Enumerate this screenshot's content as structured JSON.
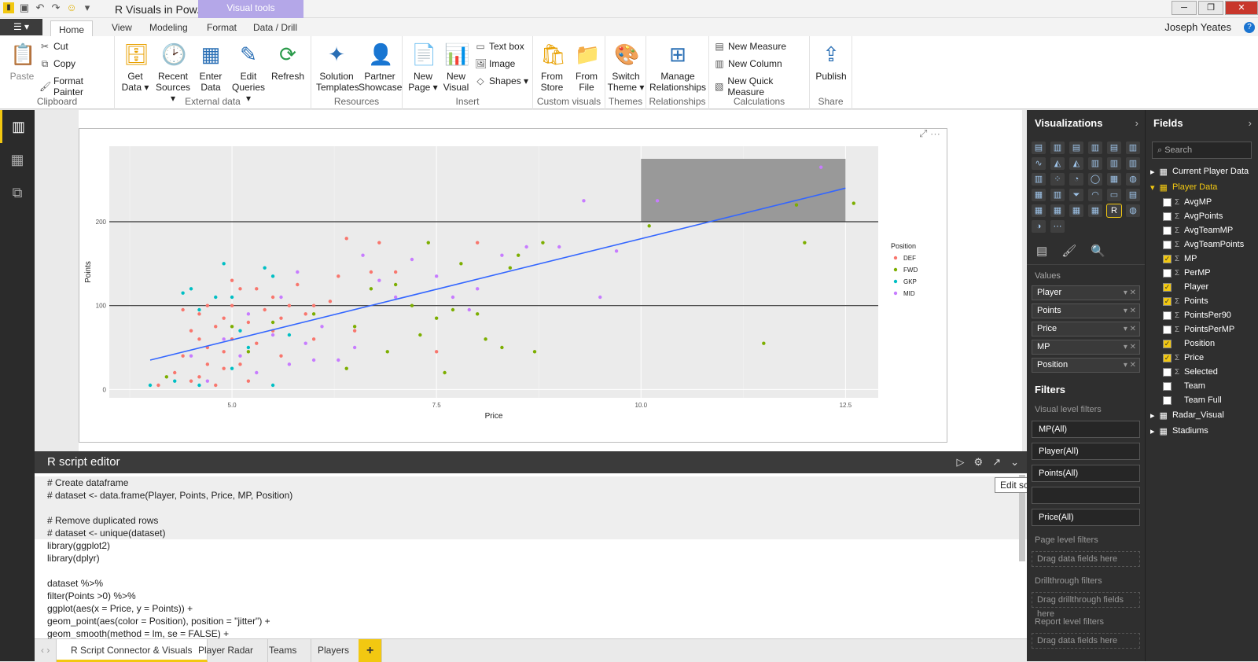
{
  "app": {
    "title": "R Visuals in Pow...",
    "context_tab": "Visual tools",
    "user": "Joseph Yeates"
  },
  "ribbon_tabs": [
    "Home",
    "View",
    "Modeling",
    "Format",
    "Data / Drill"
  ],
  "ribbon": {
    "clipboard": {
      "label": "Clipboard",
      "paste": "Paste",
      "cut": "Cut",
      "copy": "Copy",
      "format_painter": "Format Painter"
    },
    "external": {
      "label": "External data",
      "get_data": "Get Data ▾",
      "recent": "Recent Sources ▾",
      "enter": "Enter Data",
      "edit": "Edit Queries ▾",
      "refresh": "Refresh"
    },
    "resources": {
      "label": "Resources",
      "solution": "Solution Templates",
      "partner": "Partner Showcase"
    },
    "insert": {
      "label": "Insert",
      "new_page": "New Page ▾",
      "new_visual": "New Visual",
      "text_box": "Text box",
      "image": "Image",
      "shapes": "Shapes ▾"
    },
    "custom": {
      "label": "Custom visuals",
      "from_store": "From Store",
      "from_file": "From File"
    },
    "themes": {
      "label": "Themes",
      "switch": "Switch Theme ▾"
    },
    "relationships": {
      "label": "Relationships",
      "manage": "Manage Relationships"
    },
    "calculations": {
      "label": "Calculations",
      "new_measure": "New Measure",
      "new_column": "New Column",
      "new_quick": "New Quick Measure"
    },
    "share": {
      "label": "Share",
      "publish": "Publish"
    }
  },
  "chart_data": {
    "type": "scatter",
    "xlabel": "Price",
    "ylabel": "Points",
    "xlim": [
      3.5,
      12.9
    ],
    "ylim": [
      -10,
      290
    ],
    "xticks": [
      "5.0",
      "7.5",
      "10.0",
      "12.5"
    ],
    "yticks": [
      "0",
      "100",
      "200"
    ],
    "hlines": [
      100,
      200
    ],
    "highlight_rect": {
      "x": [
        10.0,
        12.5
      ],
      "y": [
        200,
        275
      ]
    },
    "trend": {
      "x": [
        4.0,
        12.5
      ],
      "y": [
        35,
        240
      ]
    },
    "legend": {
      "title": "Position",
      "entries": [
        "DEF",
        "FWD",
        "GKP",
        "MID"
      ],
      "placement": "right"
    },
    "colors": {
      "DEF": "#f8766d",
      "FWD": "#7cae00",
      "GKP": "#00bfc4",
      "MID": "#c77cff"
    },
    "series": [
      {
        "name": "DEF",
        "points": [
          [
            4.1,
            5
          ],
          [
            4.3,
            20
          ],
          [
            4.4,
            40
          ],
          [
            4.5,
            70
          ],
          [
            4.5,
            10
          ],
          [
            4.6,
            60
          ],
          [
            4.6,
            90
          ],
          [
            4.7,
            30
          ],
          [
            4.7,
            50
          ],
          [
            4.8,
            75
          ],
          [
            4.8,
            5
          ],
          [
            4.9,
            45
          ],
          [
            4.9,
            85
          ],
          [
            5.0,
            130
          ],
          [
            5.0,
            60
          ],
          [
            5.0,
            100
          ],
          [
            5.1,
            120
          ],
          [
            5.1,
            30
          ],
          [
            5.2,
            80
          ],
          [
            5.2,
            10
          ],
          [
            5.3,
            55
          ],
          [
            5.4,
            95
          ],
          [
            5.5,
            70
          ],
          [
            5.5,
            110
          ],
          [
            5.6,
            40
          ],
          [
            5.7,
            100
          ],
          [
            5.8,
            125
          ],
          [
            5.9,
            90
          ],
          [
            6.0,
            60
          ],
          [
            6.0,
            100
          ],
          [
            6.2,
            105
          ],
          [
            6.3,
            135
          ],
          [
            6.4,
            180
          ],
          [
            6.5,
            70
          ],
          [
            6.7,
            140
          ],
          [
            6.8,
            175
          ],
          [
            7.0,
            140
          ],
          [
            7.5,
            45
          ],
          [
            8.0,
            175
          ],
          [
            4.4,
            95
          ],
          [
            4.7,
            100
          ],
          [
            5.3,
            120
          ],
          [
            5.6,
            85
          ],
          [
            4.6,
            15
          ],
          [
            4.9,
            25
          ]
        ]
      },
      {
        "name": "FWD",
        "points": [
          [
            4.2,
            15
          ],
          [
            5.0,
            75
          ],
          [
            5.2,
            45
          ],
          [
            5.5,
            80
          ],
          [
            6.0,
            90
          ],
          [
            6.5,
            75
          ],
          [
            6.7,
            120
          ],
          [
            7.0,
            125
          ],
          [
            7.2,
            100
          ],
          [
            7.4,
            175
          ],
          [
            7.5,
            85
          ],
          [
            7.7,
            95
          ],
          [
            7.8,
            150
          ],
          [
            8.0,
            90
          ],
          [
            8.1,
            60
          ],
          [
            8.3,
            50
          ],
          [
            8.4,
            145
          ],
          [
            8.5,
            160
          ],
          [
            8.7,
            45
          ],
          [
            8.8,
            175
          ],
          [
            10.1,
            195
          ],
          [
            11.5,
            55
          ],
          [
            11.9,
            220
          ],
          [
            12.0,
            175
          ],
          [
            12.6,
            222
          ],
          [
            6.4,
            25
          ],
          [
            7.3,
            65
          ],
          [
            6.9,
            45
          ],
          [
            7.6,
            20
          ]
        ]
      },
      {
        "name": "GKP",
        "points": [
          [
            4.0,
            5
          ],
          [
            4.3,
            10
          ],
          [
            4.4,
            115
          ],
          [
            4.5,
            120
          ],
          [
            4.6,
            5
          ],
          [
            4.8,
            110
          ],
          [
            4.9,
            150
          ],
          [
            5.0,
            110
          ],
          [
            5.0,
            25
          ],
          [
            5.2,
            50
          ],
          [
            5.4,
            145
          ],
          [
            5.5,
            135
          ],
          [
            5.5,
            5
          ],
          [
            5.7,
            65
          ],
          [
            4.6,
            95
          ],
          [
            5.1,
            70
          ]
        ]
      },
      {
        "name": "MID",
        "points": [
          [
            4.5,
            40
          ],
          [
            4.7,
            10
          ],
          [
            4.9,
            60
          ],
          [
            5.1,
            40
          ],
          [
            5.2,
            90
          ],
          [
            5.3,
            20
          ],
          [
            5.5,
            65
          ],
          [
            5.6,
            110
          ],
          [
            5.7,
            30
          ],
          [
            5.9,
            55
          ],
          [
            6.1,
            75
          ],
          [
            6.3,
            35
          ],
          [
            6.5,
            50
          ],
          [
            6.8,
            130
          ],
          [
            7.0,
            110
          ],
          [
            7.2,
            155
          ],
          [
            7.5,
            135
          ],
          [
            7.7,
            110
          ],
          [
            7.9,
            95
          ],
          [
            8.0,
            120
          ],
          [
            8.3,
            160
          ],
          [
            8.6,
            170
          ],
          [
            9.0,
            170
          ],
          [
            9.3,
            225
          ],
          [
            9.7,
            165
          ],
          [
            10.2,
            225
          ],
          [
            12.2,
            265
          ],
          [
            9.5,
            110
          ],
          [
            5.8,
            140
          ],
          [
            6.0,
            35
          ],
          [
            6.6,
            160
          ]
        ]
      }
    ]
  },
  "r_editor": {
    "title": "R script editor",
    "lines": [
      "# Create dataframe",
      "# dataset <- data.frame(Player, Points, Price, MP, Position)",
      "",
      "# Remove duplicated rows",
      "# dataset <- unique(dataset)",
      "library(ggplot2)",
      "library(dplyr)",
      "",
      "dataset %>%",
      "filter(Points >0) %>%",
      "ggplot(aes(x = Price, y = Points)) +",
      "geom_point(aes(color = Position), position = \"jitter\") +",
      "geom_smooth(method = lm, se = FALSE) +"
    ],
    "tooltip": "Edit script in external R IDE"
  },
  "page_tabs": [
    "R Script Connector & Visuals",
    "Player Radar",
    "Teams",
    "Players",
    "+"
  ],
  "viz_pane": {
    "title": "Visualizations",
    "values_label": "Values",
    "wells": [
      "Player",
      "Points",
      "Price",
      "MP",
      "Position"
    ],
    "filters_title": "Filters",
    "visual_level": "Visual level filters",
    "visual_filters": [
      "MP(All)",
      "Player(All)",
      "Points(All)",
      "",
      "Price(All)"
    ],
    "page_level": "Page level filters",
    "drag1": "Drag data fields here",
    "drill": "Drillthrough filters",
    "drag2": "Drag drillthrough fields here",
    "report_level": "Report level filters",
    "drag3": "Drag data fields here"
  },
  "fields_pane": {
    "title": "Fields",
    "search": "Search",
    "tables": [
      "Current Player Data",
      "Player Data",
      "Radar_Visual",
      "Stadiums"
    ],
    "fields": [
      {
        "name": "AvgMP",
        "checked": false,
        "sigma": true
      },
      {
        "name": "AvgPoints",
        "checked": false,
        "sigma": true
      },
      {
        "name": "AvgTeamMP",
        "checked": false,
        "sigma": true
      },
      {
        "name": "AvgTeamPoints",
        "checked": false,
        "sigma": true
      },
      {
        "name": "MP",
        "checked": true,
        "sigma": true
      },
      {
        "name": "PerMP",
        "checked": false,
        "sigma": true
      },
      {
        "name": "Player",
        "checked": true,
        "sigma": false
      },
      {
        "name": "Points",
        "checked": true,
        "sigma": true
      },
      {
        "name": "PointsPer90",
        "checked": false,
        "sigma": true
      },
      {
        "name": "PointsPerMP",
        "checked": false,
        "sigma": true
      },
      {
        "name": "Position",
        "checked": true,
        "sigma": false
      },
      {
        "name": "Price",
        "checked": true,
        "sigma": true
      },
      {
        "name": "Selected",
        "checked": false,
        "sigma": true
      },
      {
        "name": "Team",
        "checked": false,
        "sigma": false
      },
      {
        "name": "Team Full",
        "checked": false,
        "sigma": false
      }
    ]
  }
}
